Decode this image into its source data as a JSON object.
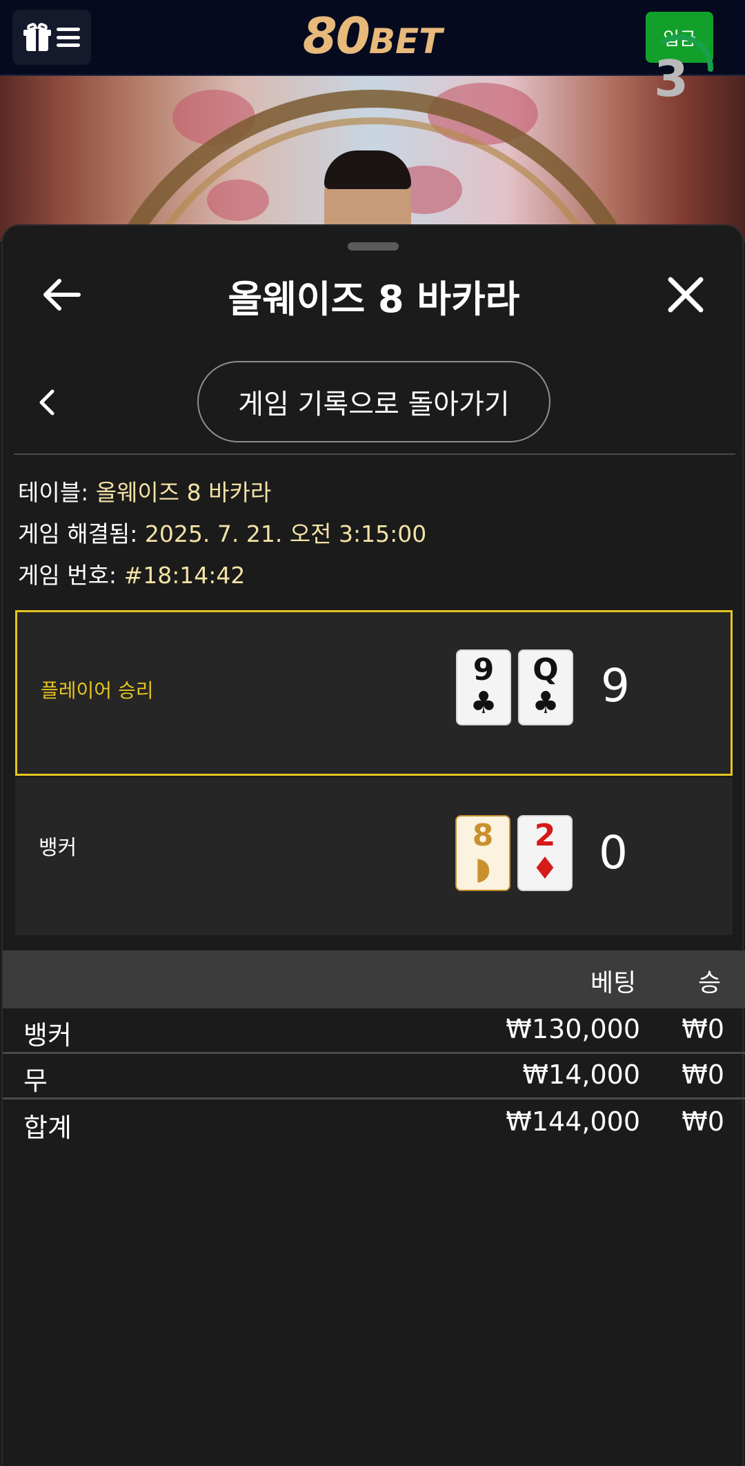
{
  "header": {
    "logo_main": "80",
    "logo_sub": "BET",
    "deposit_label": "입금"
  },
  "video": {
    "countdown": "3"
  },
  "sheet": {
    "title": "올웨이즈 8 바카라",
    "history_button": "게임 기록으로 돌아가기"
  },
  "info": {
    "table_label": "테이블: ",
    "table_value": "올웨이즈 8 바카라",
    "resolved_label": "게임 해결됨: ",
    "resolved_value": "2025. 7. 21. 오전 3:15:00",
    "number_label": "게임 번호: ",
    "number_value": "#18:14:42"
  },
  "results": {
    "player": {
      "label": "플레이어 승리",
      "label_color": "#e6c51f",
      "cards": [
        {
          "rank": "9",
          "suit": "♣",
          "color": "black"
        },
        {
          "rank": "Q",
          "suit": "♣",
          "color": "black"
        }
      ],
      "score": "9"
    },
    "banker": {
      "label": "뱅커",
      "cards": [
        {
          "rank": "8",
          "suit": "◗",
          "color": "gold"
        },
        {
          "rank": "2",
          "suit": "♦",
          "color": "red"
        }
      ],
      "score": "0"
    }
  },
  "bets_table": {
    "headers": {
      "bet": "베팅",
      "win": "승"
    },
    "rows": [
      {
        "name": "뱅커",
        "bet": "₩130,000",
        "win": "₩0"
      },
      {
        "name": "무",
        "bet": "₩14,000",
        "win": "₩0"
      },
      {
        "name": "합계",
        "bet": "₩144,000",
        "win": "₩0"
      }
    ]
  },
  "colors": {
    "accent_gold": "#e6c51f",
    "value_text": "#f4e3a6",
    "deposit_green": "#13a02a",
    "header_bg": "#050a1f"
  }
}
